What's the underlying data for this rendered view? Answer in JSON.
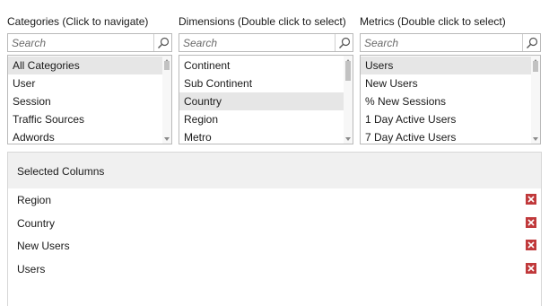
{
  "categories": {
    "title": "Categories (Click to navigate)",
    "search_placeholder": "Search",
    "items": [
      {
        "label": "All Categories",
        "selected": true
      },
      {
        "label": "User",
        "selected": false
      },
      {
        "label": "Session",
        "selected": false
      },
      {
        "label": "Traffic Sources",
        "selected": false
      },
      {
        "label": "Adwords",
        "selected": false
      }
    ]
  },
  "dimensions": {
    "title": "Dimensions (Double click to select)",
    "search_placeholder": "Search",
    "items": [
      {
        "label": "Continent",
        "selected": false
      },
      {
        "label": "Sub Continent",
        "selected": false
      },
      {
        "label": "Country",
        "selected": true
      },
      {
        "label": "Region",
        "selected": false
      },
      {
        "label": "Metro",
        "selected": false
      }
    ]
  },
  "metrics": {
    "title": "Metrics (Double click to select)",
    "search_placeholder": "Search",
    "items": [
      {
        "label": "Users",
        "selected": true
      },
      {
        "label": "New Users",
        "selected": false
      },
      {
        "label": "% New Sessions",
        "selected": false
      },
      {
        "label": "1 Day Active Users",
        "selected": false
      },
      {
        "label": "7 Day Active Users",
        "selected": false
      }
    ]
  },
  "selected_columns": {
    "title": "Selected Columns",
    "items": [
      {
        "label": "Region"
      },
      {
        "label": "Country"
      },
      {
        "label": "New Users"
      },
      {
        "label": "Users"
      }
    ]
  },
  "icons": {
    "search": "search-icon",
    "remove": "close-icon",
    "scroll_up": "triangle-up-icon",
    "scroll_down": "triangle-down-icon"
  },
  "colors": {
    "remove_button": "#c0393b",
    "selected_item_bg": "#e6e6e6",
    "header_bg": "#f0f0f0"
  }
}
